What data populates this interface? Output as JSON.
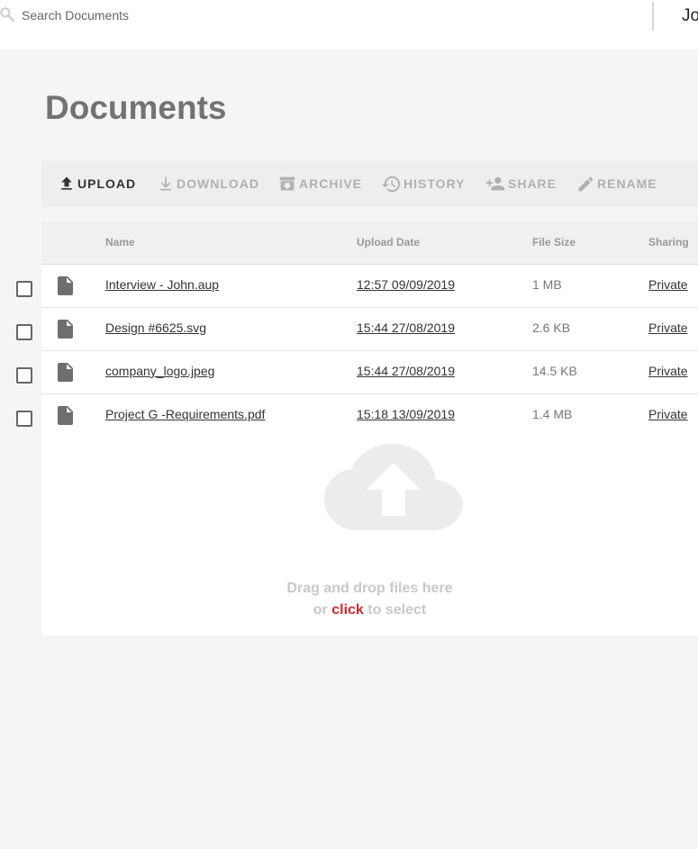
{
  "search": {
    "placeholder": "Search Documents",
    "icon": "search-icon"
  },
  "user": {
    "name": "Jo"
  },
  "page": {
    "title": "Documents"
  },
  "toolbar": {
    "upload": "UPLOAD",
    "download": "DOWNLOAD",
    "archive": "ARCHIVE",
    "history": "HISTORY",
    "share": "SHARE",
    "rename": "RENAME",
    "active_color": "#333333",
    "disabled_color": "#b0b0b0"
  },
  "table": {
    "columns": {
      "name": "Name",
      "upload_date": "Upload Date",
      "file_size": "File Size",
      "sharing": "Sharing"
    },
    "rows": [
      {
        "name": "Interview - John.aup",
        "date": "12:57 09/09/2019",
        "size": "1 MB",
        "sharing": "Private"
      },
      {
        "name": "Design #6625.svg",
        "date": "15:44 27/08/2019",
        "size": "2.6 KB",
        "sharing": "Private"
      },
      {
        "name": "company_logo.jpeg",
        "date": "15:44 27/08/2019",
        "size": "14.5 KB",
        "sharing": "Private"
      },
      {
        "name": "Project G -Requirements.pdf",
        "date": "15:18 13/09/2019",
        "size": "1.4 MB",
        "sharing": "Private"
      }
    ]
  },
  "dropzone": {
    "line1": "Drag and drop files here",
    "or": "or",
    "click": "click",
    "to_select": "to select",
    "click_color": "#cc2c2c"
  }
}
